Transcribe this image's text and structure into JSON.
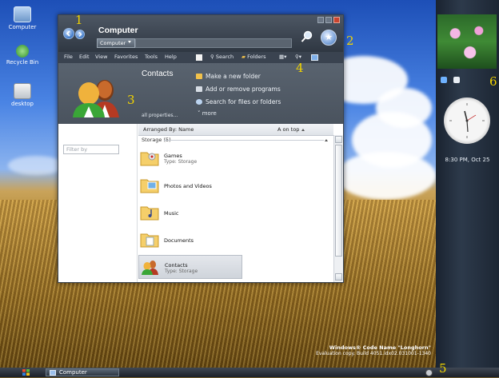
{
  "desktop": {
    "icons": [
      {
        "label": "Computer",
        "icon": "computer-icon"
      },
      {
        "label": "Recycle Bin",
        "icon": "recycle-bin-icon"
      },
      {
        "label": "desktop",
        "icon": "folder-icon"
      }
    ],
    "branding": {
      "line1": "Windows® Code Name \"Longhorn\"",
      "line2": "Evaluation copy. Build 4051.idx02.031001-1340"
    }
  },
  "window": {
    "title": "Computer",
    "address": "Computer",
    "menu": [
      "File",
      "Edit",
      "View",
      "Favorites",
      "Tools",
      "Help"
    ],
    "toolbar": {
      "search": "Search",
      "folders": "Folders"
    },
    "tasks": {
      "heading": "Contacts",
      "all_properties": "all properties...",
      "links": [
        "Make a new folder",
        "Add or remove programs",
        "Search for files or folders"
      ],
      "more": "more"
    },
    "filter_placeholder": "Filter by",
    "arrange": {
      "label": "Arranged By: Name",
      "order": "A on top"
    },
    "group": "Storage (5)",
    "items": [
      {
        "name": "Games",
        "type": "Type: Storage",
        "icon": "games-folder-icon"
      },
      {
        "name": "Photos and Videos",
        "type": "",
        "icon": "photos-folder-icon"
      },
      {
        "name": "Music",
        "type": "",
        "icon": "music-folder-icon"
      },
      {
        "name": "Documents",
        "type": "",
        "icon": "documents-folder-icon"
      },
      {
        "name": "Contacts",
        "type": "Type: Storage",
        "icon": "contacts-icon"
      }
    ]
  },
  "sidebar": {
    "clock_text": "8:30 PM, Oct 25"
  },
  "taskbar": {
    "task_label": "Computer"
  },
  "callouts": [
    "1",
    "2",
    "3",
    "4",
    "5",
    "6"
  ],
  "colors": {
    "callout": "#f2d400",
    "accent": "#3d78c8"
  }
}
